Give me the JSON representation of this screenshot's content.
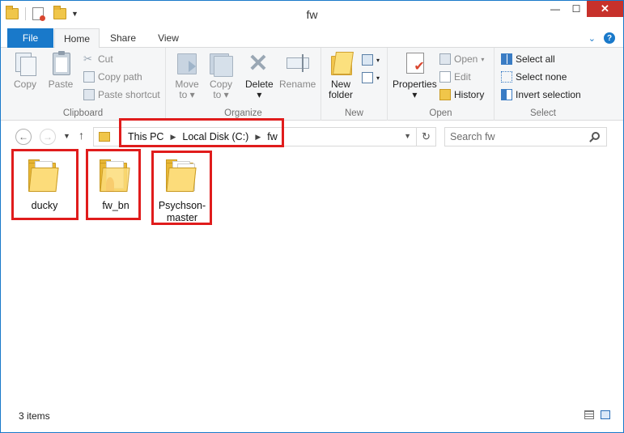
{
  "window": {
    "title": "fw",
    "controls": {
      "minimize": "—",
      "maximize": "☐",
      "close": "✕"
    }
  },
  "ribbon_tabs": [
    {
      "label": "File"
    },
    {
      "label": "Home"
    },
    {
      "label": "Share"
    },
    {
      "label": "View"
    }
  ],
  "ribbon": {
    "clipboard": {
      "label": "Clipboard",
      "copy": "Copy",
      "paste": "Paste",
      "cut": "Cut",
      "copy_path": "Copy path",
      "paste_shortcut": "Paste shortcut"
    },
    "organize": {
      "label": "Organize",
      "move_to_1": "Move",
      "move_to_2": "to",
      "copy_to_1": "Copy",
      "copy_to_2": "to",
      "delete": "Delete",
      "rename": "Rename"
    },
    "new": {
      "label": "New",
      "new_folder_1": "New",
      "new_folder_2": "folder"
    },
    "open": {
      "label": "Open",
      "properties": "Properties",
      "open": "Open",
      "edit": "Edit",
      "history": "History"
    },
    "select": {
      "label": "Select",
      "select_all": "Select all",
      "select_none": "Select none",
      "invert_selection": "Invert selection"
    }
  },
  "address": {
    "crumbs": [
      "This PC",
      "Local Disk (C:)",
      "fw"
    ]
  },
  "search": {
    "placeholder": "Search fw"
  },
  "items": [
    {
      "name": "ducky"
    },
    {
      "name": "fw_bn"
    },
    {
      "name_line1": "Psychson-",
      "name_line2": "master"
    }
  ],
  "status": {
    "count": "3 items"
  },
  "colors": {
    "accent": "#1979ca",
    "highlight": "#e01c1c",
    "folder": "#f0c64a"
  }
}
